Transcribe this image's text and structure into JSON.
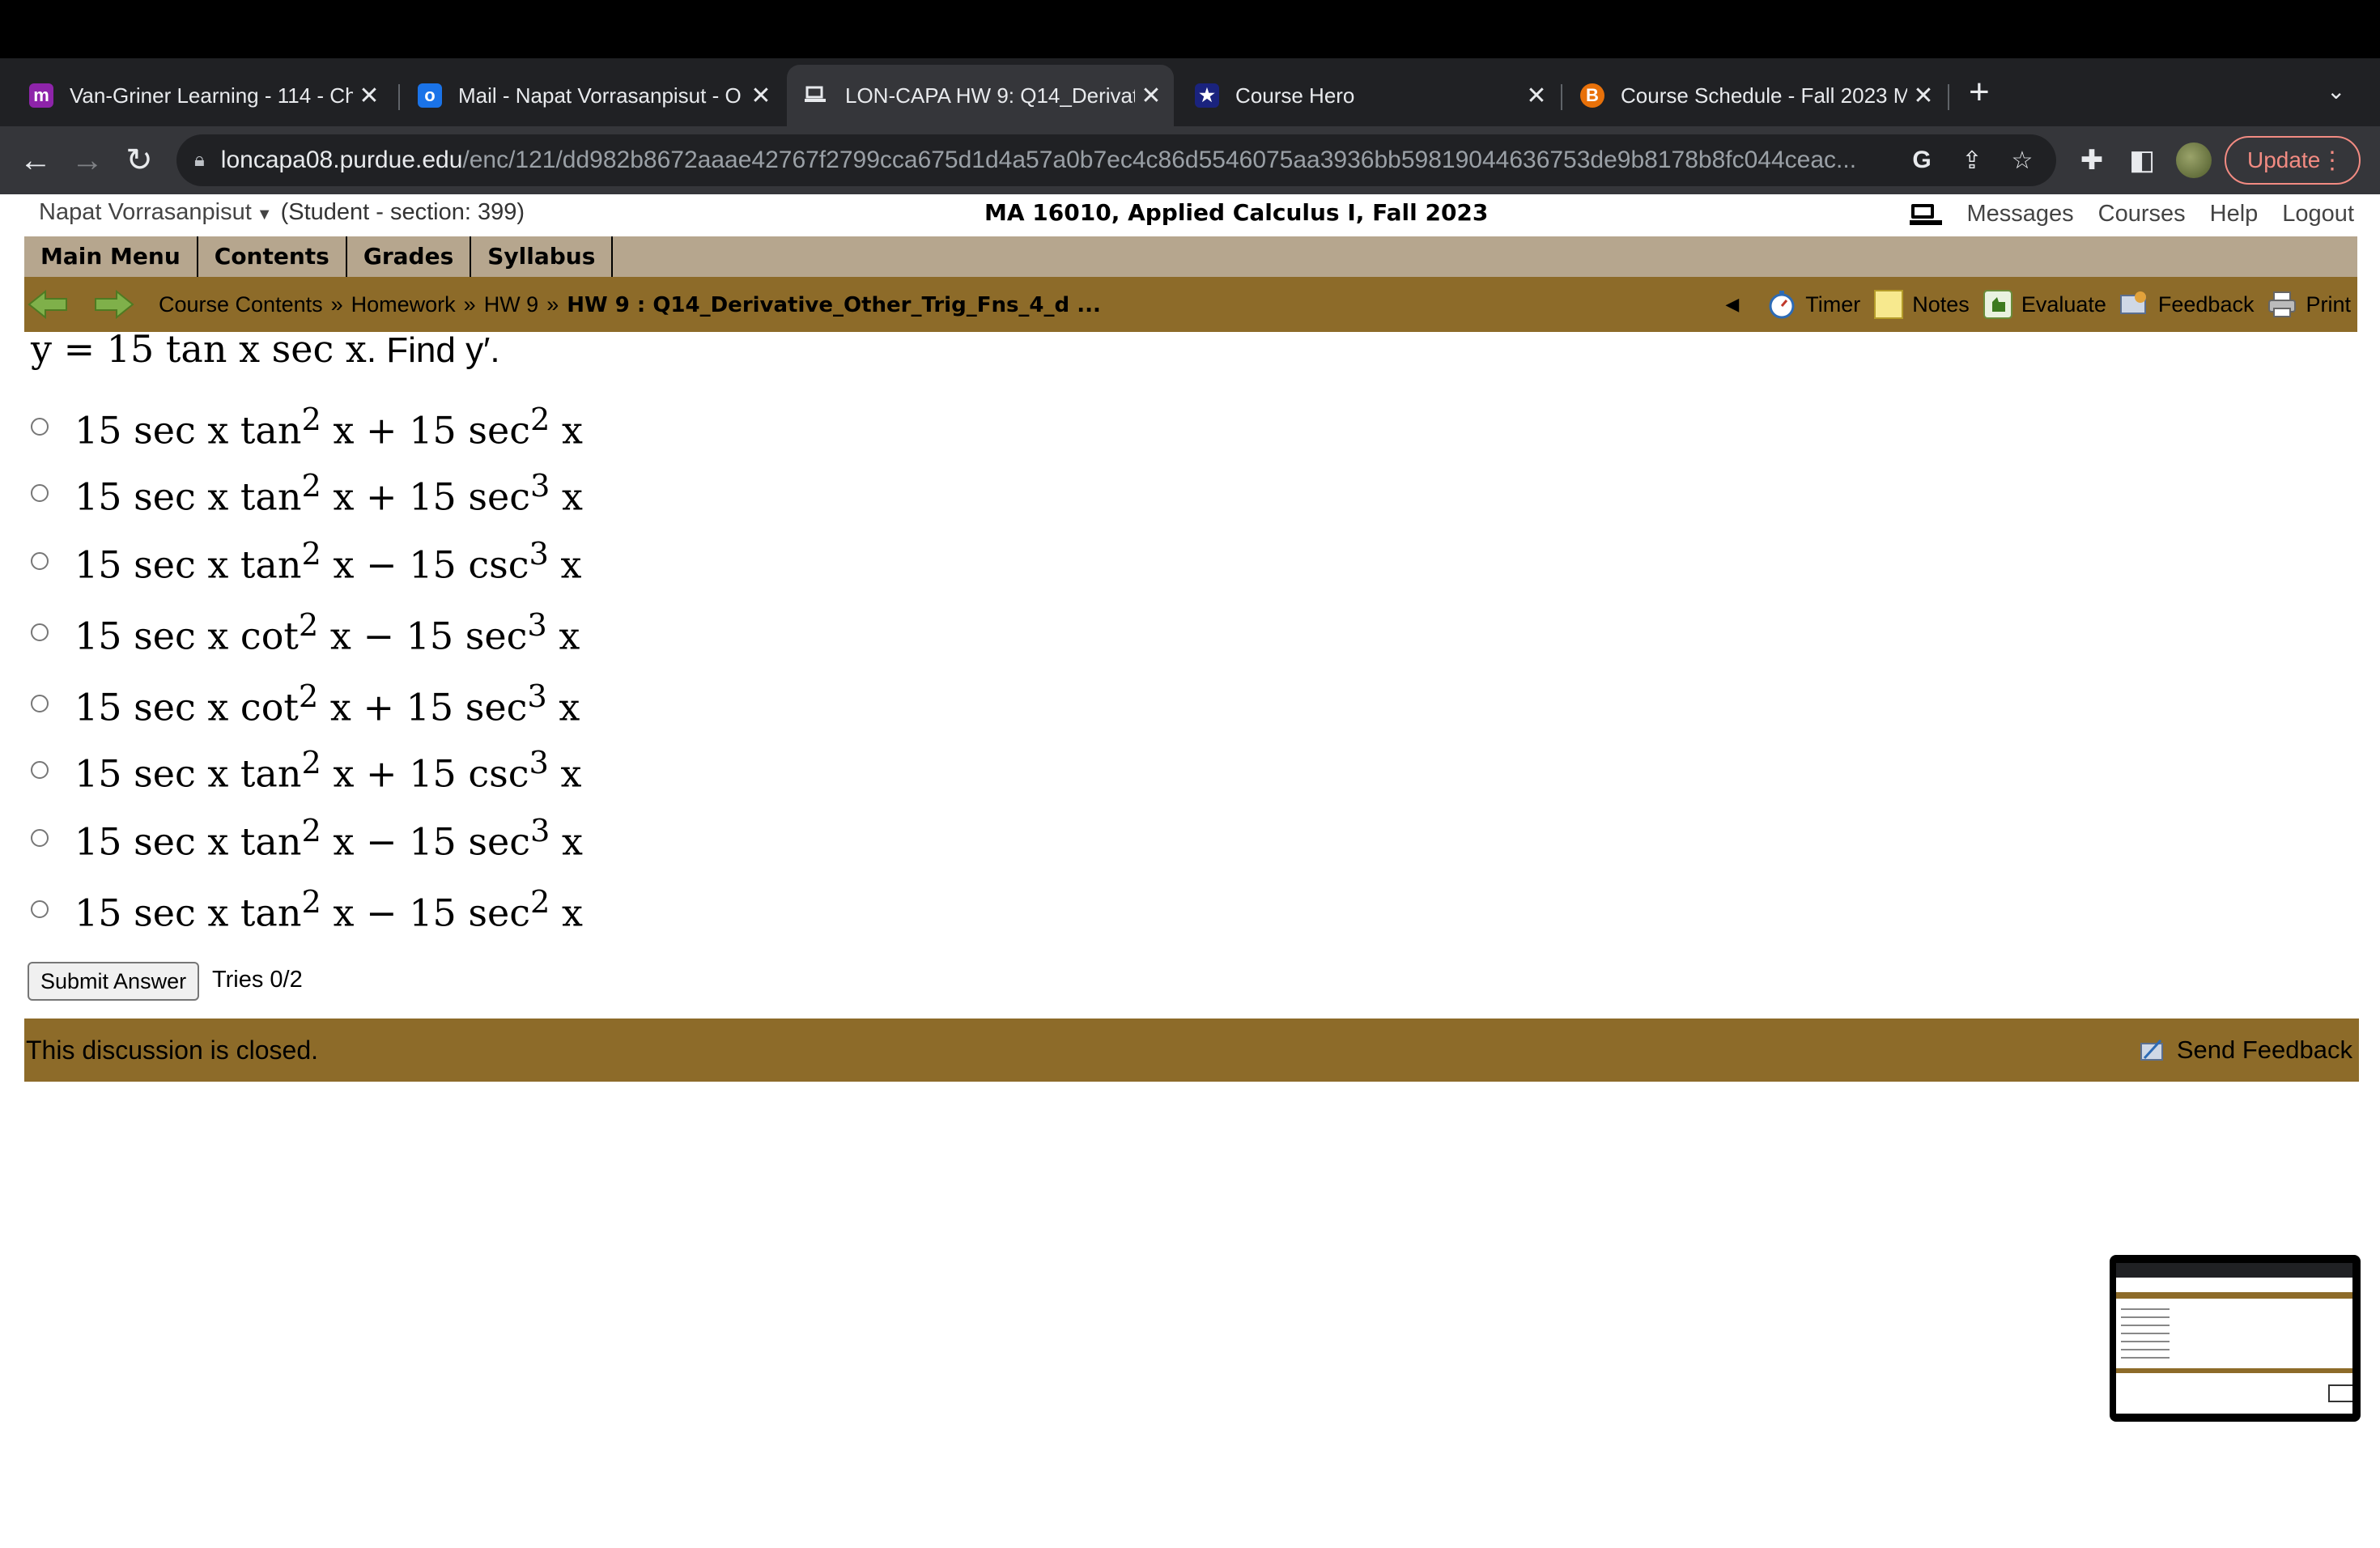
{
  "browser": {
    "tabs": [
      {
        "title": "Van-Griner Learning - 114 - Ch",
        "icon": "m-logo-icon",
        "color": "#8e24aa",
        "glyph": "m",
        "active": false
      },
      {
        "title": "Mail - Napat Vorrasanpisut - O",
        "icon": "outlook-icon",
        "color": "#1a73e8",
        "glyph": "o",
        "active": false
      },
      {
        "title": "LON-CAPA HW 9: Q14_Derivat",
        "icon": "loncapa-icon",
        "color": "#35363a",
        "glyph": "",
        "active": true
      },
      {
        "title": "Course Hero",
        "icon": "course-hero-icon",
        "color": "#1a237e",
        "glyph": "★",
        "active": false
      },
      {
        "title": "Course Schedule - Fall 2023 M",
        "icon": "purdue-b-icon",
        "color": "#e8710a",
        "glyph": "B",
        "active": false
      }
    ],
    "url_host": "loncapa08.purdue.edu",
    "url_path": "/enc/121/dd982b8672aaae42767f2799cca675d1d4a57a0b7ec4c86d5546075aa3936bb59819044636753de9b8178b8fc044ceac...",
    "update_label": "Update"
  },
  "header": {
    "user_name": "Napat Vorrasanpisut",
    "role": "(Student  - section: 399)",
    "course": "MA 16010, Applied Calculus I, Fall 2023",
    "links": {
      "messages": "Messages",
      "courses": "Courses",
      "help": "Help",
      "logout": "Logout"
    }
  },
  "main_menu": [
    "Main Menu",
    "Contents",
    "Grades",
    "Syllabus"
  ],
  "breadcrumb": {
    "items": [
      "Course Contents",
      "Homework",
      "HW 9"
    ],
    "separator": "»",
    "current": "HW 9 : Q14_Derivative_Other_Trig_Fns_4_d ..."
  },
  "tools": {
    "timer": "Timer",
    "notes": "Notes",
    "evaluate": "Evaluate",
    "feedback": "Feedback",
    "print": "Print"
  },
  "question": {
    "equation": "y = 15 tan x sec x",
    "prompt": ". Find y′."
  },
  "options": [
    {
      "a": "15 sec x tan",
      "p1": "2",
      "b": " x + 15 sec",
      "p2": "2",
      "c": " x"
    },
    {
      "a": "15 sec x tan",
      "p1": "2",
      "b": " x + 15 sec",
      "p2": "3",
      "c": " x"
    },
    {
      "a": "15 sec x tan",
      "p1": "2",
      "b": " x − 15 csc",
      "p2": "3",
      "c": " x"
    },
    {
      "a": "15 sec x cot",
      "p1": "2",
      "b": " x − 15 sec",
      "p2": "3",
      "c": " x"
    },
    {
      "a": "15 sec x cot",
      "p1": "2",
      "b": " x + 15 sec",
      "p2": "3",
      "c": " x"
    },
    {
      "a": "15 sec x tan",
      "p1": "2",
      "b": " x + 15 csc",
      "p2": "3",
      "c": " x"
    },
    {
      "a": "15 sec x tan",
      "p1": "2",
      "b": " x − 15 sec",
      "p2": "3",
      "c": " x"
    },
    {
      "a": "15 sec x tan",
      "p1": "2",
      "b": " x − 15 sec",
      "p2": "2",
      "c": " x"
    }
  ],
  "submit_label": "Submit Answer",
  "tries": "Tries 0/2",
  "discussion": {
    "status": "This discussion is closed.",
    "send_feedback": "Send Feedback"
  },
  "colors": {
    "brown_bar": "#8d6b29",
    "menu_bar": "#b6a68e",
    "chrome_dark": "#202124",
    "chrome_mid": "#35363a"
  }
}
